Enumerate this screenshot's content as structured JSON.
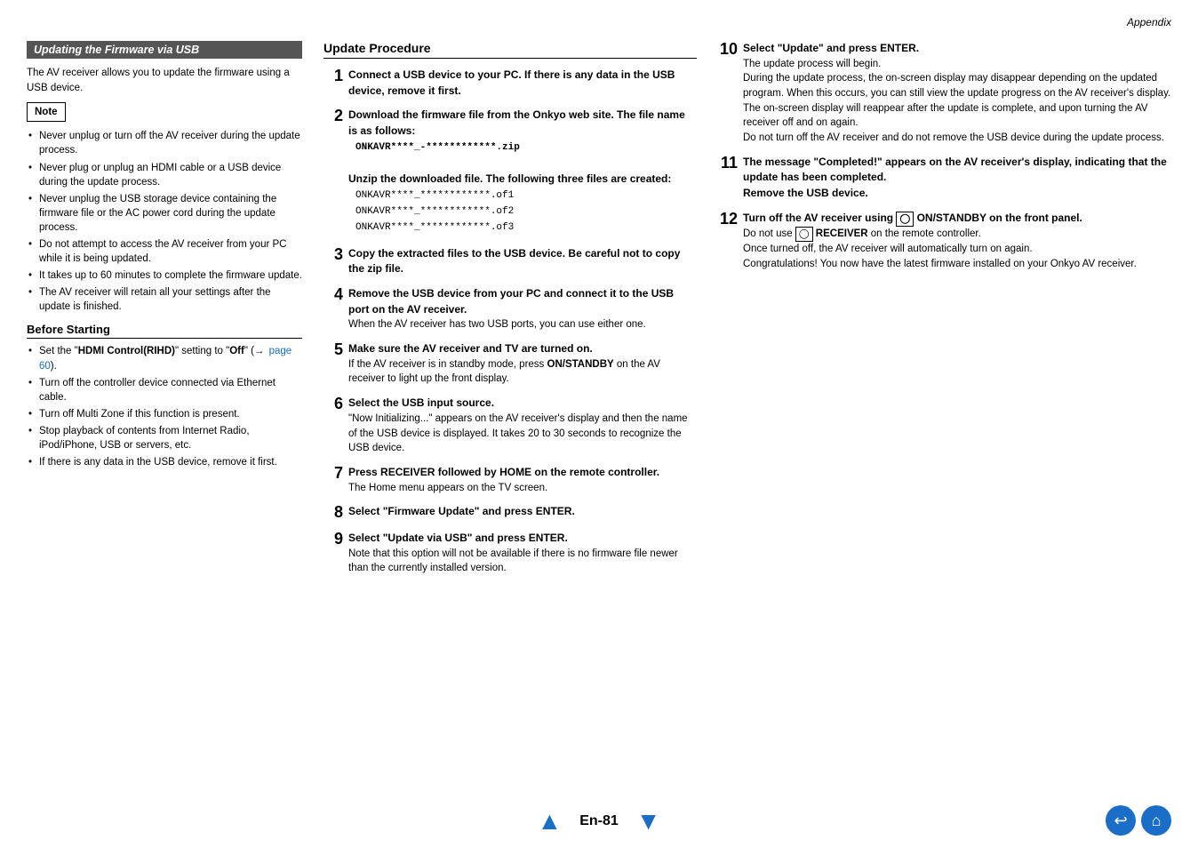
{
  "header": {
    "text": "Appendix"
  },
  "left_col": {
    "section_title": "Updating the Firmware via USB",
    "intro": "The AV receiver allows you to update the firmware using a USB device.",
    "note_label": "Note",
    "note_items": [
      "Never unplug or turn off the AV receiver during the update process.",
      "Never plug or unplug an HDMI cable or a USB device during the update process.",
      "Never unplug the USB storage device containing the firmware file or the AC power cord during the update process.",
      "Do not attempt to access the AV receiver from your PC while it is being updated.",
      "It takes up to 60 minutes to complete the firmware update.",
      "The AV receiver will retain all your settings after the update is finished."
    ],
    "before_starting_title": "Before Starting",
    "before_items": [
      "Set the \"HDMI Control(RIHD)\" setting to \"Off\" (→ page 60).",
      "Turn off the controller device connected via Ethernet cable.",
      "Turn off Multi Zone if this function is present.",
      "Stop playback of contents from Internet Radio, iPod/iPhone, USB or servers, etc.",
      "If there is any data in the USB device, remove it first."
    ]
  },
  "mid_col": {
    "update_proc_title": "Update Procedure",
    "steps": [
      {
        "number": "1",
        "bold": "Connect a USB device to your PC. If there is any data in the USB device, remove it first."
      },
      {
        "number": "2",
        "bold": "Download the firmware file from the Onkyo web site. The file name is as follows:",
        "file1": "ONKAVR****_-************.zip",
        "sub_bold": "Unzip the downloaded file. The following three files are created:",
        "file2": "ONKAVR****_************.of1",
        "file3": "ONKAVR****_************.of2",
        "file4": "ONKAVR****_************.of3"
      },
      {
        "number": "3",
        "bold": "Copy the extracted files to the USB device. Be careful not to copy the zip file."
      },
      {
        "number": "4",
        "bold": "Remove the USB device from your PC and connect it to the USB port on the AV receiver.",
        "normal": "When the AV receiver has two USB ports, you can use either one."
      },
      {
        "number": "5",
        "bold": "Make sure the AV receiver and TV are turned on.",
        "normal": "If the AV receiver is in standby mode, press ON/STANDBY on the AV receiver to light up the front display."
      },
      {
        "number": "6",
        "bold": "Select the USB input source.",
        "normal": "\"Now Initializing...\" appears on the AV receiver's display and then the name of the USB device is displayed. It takes 20 to 30 seconds to recognize the USB device."
      },
      {
        "number": "7",
        "bold": "Press RECEIVER followed by HOME on the remote controller.",
        "normal": "The Home menu appears on the TV screen."
      },
      {
        "number": "8",
        "bold": "Select \"Firmware Update\" and press ENTER."
      },
      {
        "number": "9",
        "bold": "Select \"Update via USB\" and press ENTER.",
        "normal": "Note that this option will not be available if there is no firmware file newer than the currently installed version."
      }
    ]
  },
  "right_col": {
    "steps": [
      {
        "number": "10",
        "bold": "Select “Update” and press ENTER.",
        "normal": "The update process will begin.\nDuring the update process, the on-screen display may disappear depending on the updated program. When this occurs, you can still view the update progress on the AV receiver’s display. The on-screen display will reappear after the update is complete, and upon turning the AV receiver off and on again.\nDo not turn off the AV receiver and do not remove the USB device during the update process."
      },
      {
        "number": "11",
        "bold": "The message “Completed!” appears on the AV receiver’s display, indicating that the update has been completed.\nRemove the USB device."
      },
      {
        "number": "12",
        "bold": "Turn off the AV receiver using   ON/STANDBY on the front panel.",
        "normal": "Do not use   RECEIVER on the remote controller.\nOnce turned off, the AV receiver will automatically turn on again.\nCongratulations! You now have the latest firmware installed on your Onkyo AV receiver."
      }
    ]
  },
  "footer": {
    "page": "En-81",
    "back_icon": "↩",
    "home_icon": "⌂"
  }
}
